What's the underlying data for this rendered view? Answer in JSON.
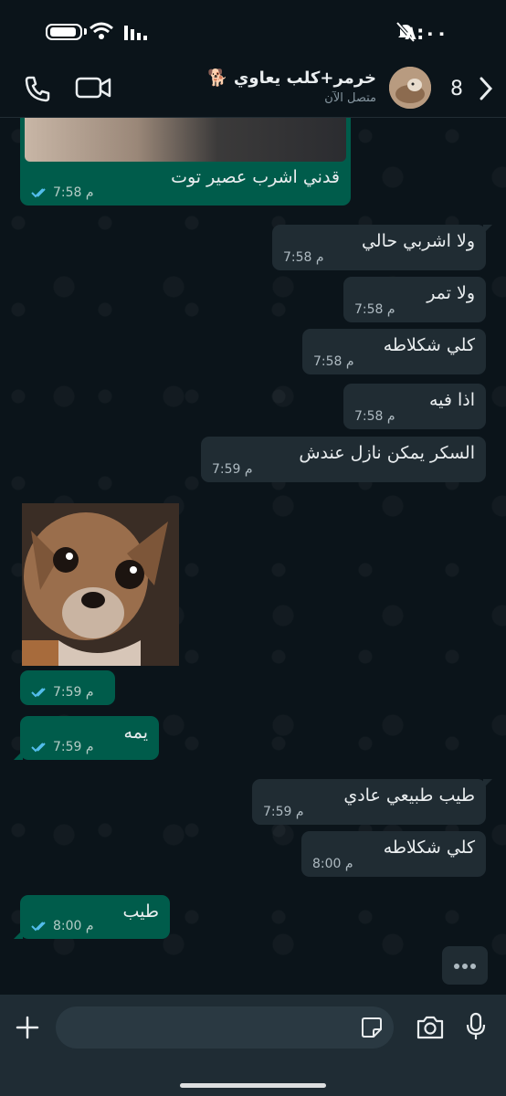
{
  "status": {
    "time": "٨:٠٠"
  },
  "header": {
    "back_count": "8",
    "contact_name": "خرمر+كلب يعاوي 🐕",
    "contact_status": "متصل الآن"
  },
  "messages": [
    {
      "dir": "out",
      "text": "قدني اشرب عصير توت",
      "time": "7:58 م",
      "has_image_above": true
    },
    {
      "dir": "in",
      "text": "ولا اشربي حالي",
      "time": "7:58 م"
    },
    {
      "dir": "in",
      "text": "ولا تمر",
      "time": "7:58 م"
    },
    {
      "dir": "in",
      "text": "كلي شكلاطه",
      "time": "7:58 م"
    },
    {
      "dir": "in",
      "text": "اذا فيه",
      "time": "7:58 م"
    },
    {
      "dir": "in",
      "text": "السكر يمكن نازل عندش",
      "time": "7:59 م"
    },
    {
      "dir": "out",
      "text": "",
      "time": "7:59 م",
      "image": "dog-sticker"
    },
    {
      "dir": "out",
      "text": "يمه",
      "time": "7:59 م"
    },
    {
      "dir": "in",
      "text": "طيب طبيعي عادي",
      "time": "7:59 م"
    },
    {
      "dir": "in",
      "text": "كلي شكلاطه",
      "time": "8:00 م"
    },
    {
      "dir": "out",
      "text": "طيب",
      "time": "8:00 م"
    }
  ],
  "icons": {
    "back": "chevron-left-icon",
    "video": "video-camera-icon",
    "phone": "phone-icon",
    "plus": "plus-icon",
    "sticker": "sticker-icon",
    "camera": "camera-icon",
    "mic": "microphone-icon"
  },
  "colors": {
    "bg": "#0b141a",
    "incoming": "#202c33",
    "outgoing": "#005c4b",
    "read_ticks": "#53bdeb"
  }
}
